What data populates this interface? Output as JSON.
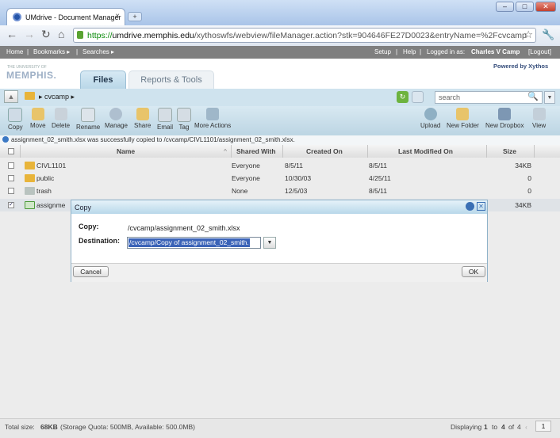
{
  "browser": {
    "tab_title": "UMdrive - Document Manager",
    "new_tab": "+",
    "tab_close": "×",
    "url_https": "https://",
    "url_host": "umdrive.memphis.edu",
    "url_path": "/xythoswfs/webview/fileManager.action?stk=904646FE27D0023&entryName=%2Fcvcamp",
    "win_min": "–",
    "win_max": "□",
    "win_close": "✕"
  },
  "appbar": {
    "home": "Home",
    "bookmarks": "Bookmarks ▸",
    "searches": "Searches ▸",
    "setup": "Setup",
    "help": "Help",
    "logged_in": "Logged in as:",
    "user": "Charles V Camp",
    "logout": "[Logout]"
  },
  "header": {
    "logo_small": "THE UNIVERSITY OF",
    "logo": "MEMPHIS.",
    "powered": "Powered by Xythos",
    "tabs": [
      "Files",
      "Reports & Tools"
    ]
  },
  "pathbar": {
    "path": "▸ cvcamp ▸",
    "search_placeholder": "search"
  },
  "actions": [
    "Copy",
    "Move",
    "Delete",
    "Rename",
    "Manage",
    "Share",
    "Email",
    "Tag",
    "More Actions",
    "Upload",
    "New Folder",
    "New Dropbox",
    "View"
  ],
  "message": "assignment_02_smith.xlsx was successfully copied to /cvcamp/CIVL1101/assignment_02_smith.xlsx.",
  "table": {
    "headers": [
      "Name",
      "Shared With",
      "Created On",
      "Last Modified On",
      "Size"
    ],
    "rows": [
      {
        "name": "CIVL1101",
        "shared": "Everyone",
        "created": "8/5/11",
        "modified": "8/5/11",
        "size": "34KB",
        "checked": ""
      },
      {
        "name": "public",
        "shared": "Everyone",
        "created": "10/30/03",
        "modified": "4/25/11",
        "size": "0",
        "checked": ""
      },
      {
        "name": "trash",
        "shared": "None",
        "created": "12/5/03",
        "modified": "8/5/11",
        "size": "0",
        "checked": ""
      },
      {
        "name": "assignme",
        "shared": "",
        "created": "",
        "modified": "",
        "size": "34KB",
        "checked": "✓"
      }
    ]
  },
  "dialog": {
    "title": "Copy",
    "copy_label": "Copy:",
    "copy_value": "/cvcamp/assignment_02_smith.xlsx",
    "dest_label": "Destination:",
    "dest_value": "/cvcamp/Copy of assignment_02_smith.",
    "cancel": "Cancel",
    "ok": "OK"
  },
  "footer": {
    "total_label": "Total size:",
    "total_value": "68KB",
    "quota": "(Storage Quota: 500MB, Available: 500.0MB)",
    "displaying": "Displaying",
    "range_from": "1",
    "to": "to",
    "range_to": "4",
    "of": "of",
    "count": "4",
    "page": "1"
  },
  "colors": {
    "brand_blue": "#344c7a",
    "accent_light": "#cfe3ee",
    "selection": "#3a63b7"
  }
}
